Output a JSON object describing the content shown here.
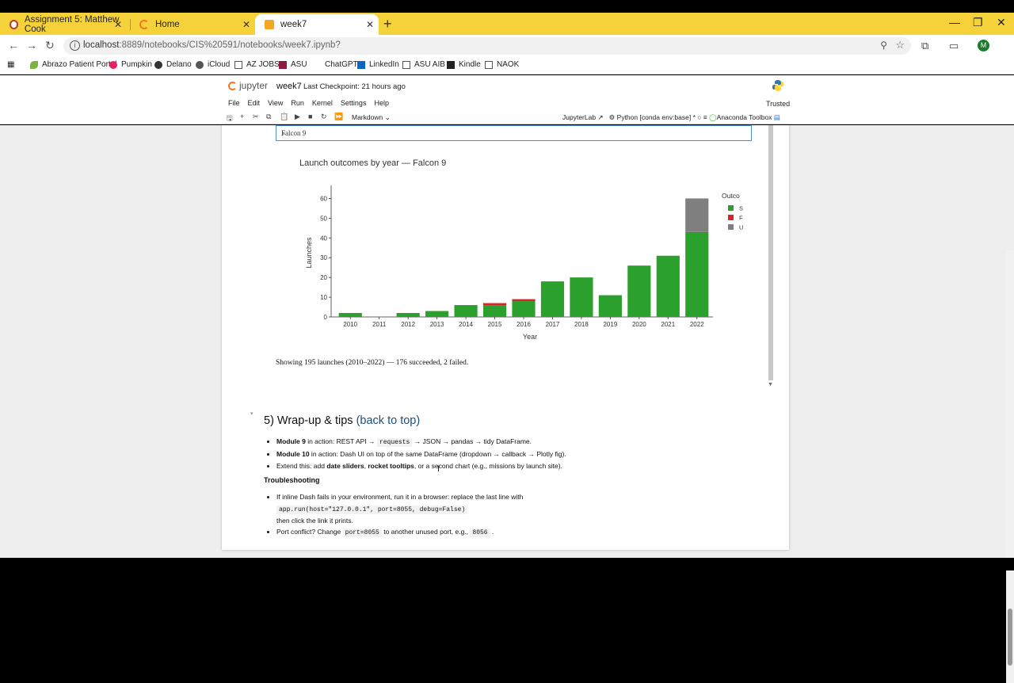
{
  "browser": {
    "tabs": [
      {
        "label": "Assignment 5: Matthew Cook",
        "active": false
      },
      {
        "label": "Home",
        "active": false
      },
      {
        "label": "week7",
        "active": true
      }
    ],
    "url_host": "localhost",
    "url_rest": ":8889/notebooks/CIS%20591/notebooks/week7.ipynb?",
    "profile_initial": "M",
    "bookmarks": [
      "Abrazo Patient Portal",
      "Pumpkin",
      "Delano",
      "iCloud",
      "AZ JOBS",
      "ASU",
      "ChatGPT",
      "LinkedIn",
      "ASU AIB",
      "Kindle",
      "NAOK"
    ]
  },
  "jupyter": {
    "logo_text": "jupyter",
    "notebook_name": "week7",
    "checkpoint": "Last Checkpoint: 21 hours ago",
    "menu": [
      "File",
      "Edit",
      "View",
      "Run",
      "Kernel",
      "Settings",
      "Help"
    ],
    "trusted": "Trusted",
    "cell_type": "Markdown",
    "jupyterlab_label": "JupyterLab",
    "kernel_label": "Python [conda env:base] *",
    "toolbox_label": "Anaconda Toolbox"
  },
  "dropdown": {
    "selected": "Falcon 9"
  },
  "chart_data": {
    "type": "bar",
    "stacked": true,
    "title": "Launch outcomes by year — Falcon 9",
    "xlabel": "Year",
    "ylabel": "Launches",
    "ylim": [
      0,
      65
    ],
    "yticks": [
      0,
      10,
      20,
      30,
      40,
      50,
      60
    ],
    "categories": [
      "2010",
      "2011",
      "2012",
      "2013",
      "2014",
      "2015",
      "2016",
      "2017",
      "2018",
      "2019",
      "2020",
      "2021",
      "2022"
    ],
    "legend_title": "Outco",
    "legend_labels": [
      "S",
      "F",
      "U"
    ],
    "legend_position": "right",
    "series": [
      {
        "name": "S",
        "color": "#2ca02c",
        "values": [
          2,
          0,
          2,
          3,
          6,
          6,
          8,
          18,
          20,
          11,
          26,
          31,
          43
        ]
      },
      {
        "name": "F",
        "color": "#d62728",
        "values": [
          0,
          0,
          0,
          0,
          0,
          1,
          1,
          0,
          0,
          0,
          0,
          0,
          0
        ]
      },
      {
        "name": "U",
        "color": "#7f7f7f",
        "values": [
          0,
          0,
          0,
          0,
          0,
          0,
          0,
          0,
          0,
          0,
          0,
          0,
          17
        ]
      }
    ]
  },
  "caption": "Showing 195 launches (2010–2022) — 176 succeeded, 2 failed.",
  "section": {
    "heading": "5) Wrap-up & tips",
    "back_link": "(back to top)",
    "bullet1_bold": "Module 9",
    "bullet1_a": " in action: REST API → ",
    "bullet1_code": "requests",
    "bullet1_b": " → JSON → pandas → tidy DataFrame.",
    "bullet2_bold": "Module 10",
    "bullet2_rest": " in action: Dash UI on top of the same DataFrame (dropdown → callback → Plotly fig).",
    "bullet3_a": "Extend this: add ",
    "bullet3_bold1": "date sliders",
    "bullet3_sep": ", ",
    "bullet3_bold2": "rocket tooltips",
    "bullet3_b": ", or a second chart (e.g., missions by launch site).",
    "troubleshooting": "Troubleshooting",
    "t1_text": "If inline Dash fails in your environment, run it in a browser: replace the last line with",
    "t1_code": "app.run(host=\"127.0.0.1\", port=8055, debug=False)",
    "t1_after": "then click the link it prints.",
    "t2_a": "Port conflict? Change ",
    "t2_code1": "port=8055",
    "t2_b": " to another unused port, e.g., ",
    "t2_code2": "8056",
    "t2_c": " ."
  }
}
